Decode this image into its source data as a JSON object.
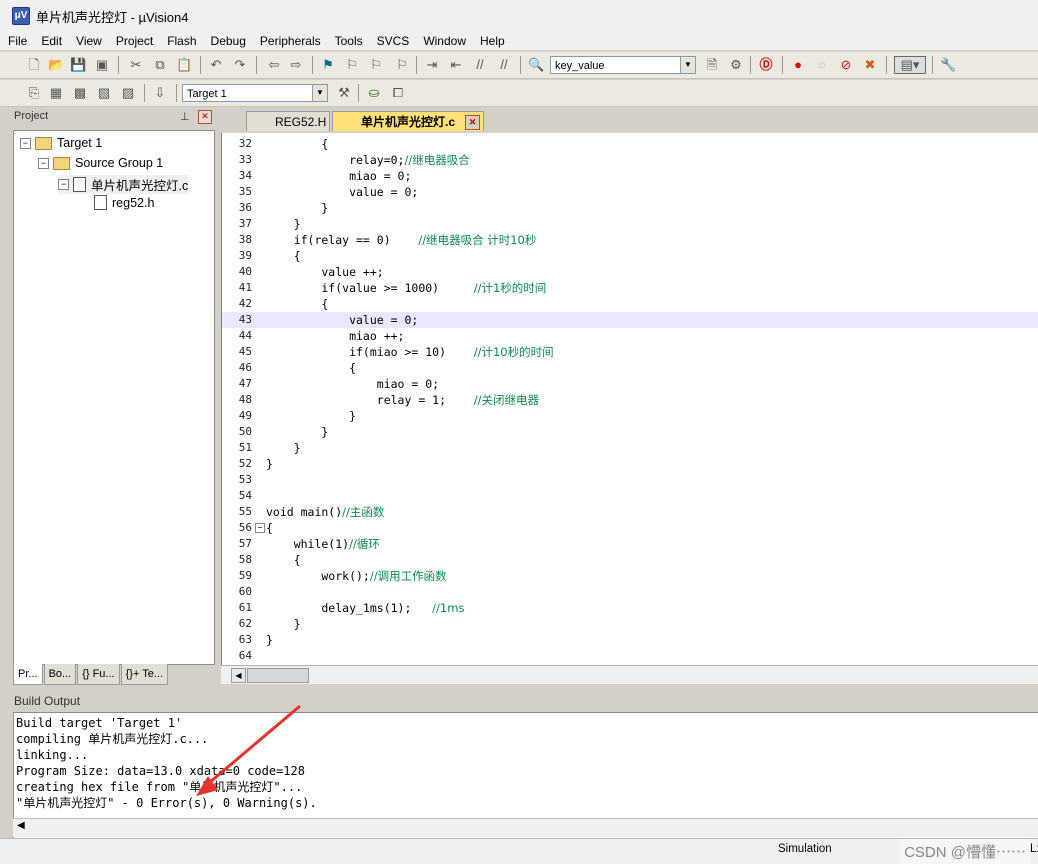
{
  "window": {
    "title": "单片机声光控灯  - µVision4",
    "app_icon": "uvision-icon"
  },
  "menu": [
    "File",
    "Edit",
    "View",
    "Project",
    "Flash",
    "Debug",
    "Peripherals",
    "Tools",
    "SVCS",
    "Window",
    "Help"
  ],
  "toolbar": {
    "find_combo_value": "key_value",
    "target_combo_value": "Target 1"
  },
  "project_panel": {
    "title": "Project",
    "tree": {
      "target": "Target 1",
      "group": "Source Group 1",
      "file1": "单片机声光控灯.c",
      "file2": "reg52.h"
    },
    "tabs": [
      "Pr...",
      "Bo...",
      "{} Fu...",
      "{}+ Te..."
    ]
  },
  "editor": {
    "tabs": [
      "REG52.H",
      "单片机声光控灯.c"
    ],
    "active_tab": 1,
    "current_line": 43,
    "lines": [
      {
        "n": "32",
        "t": "        {"
      },
      {
        "n": "33",
        "t": "            relay=0;",
        "c": "//继电器吸合"
      },
      {
        "n": "34",
        "t": "            miao = 0;"
      },
      {
        "n": "35",
        "t": "            value = 0;"
      },
      {
        "n": "36",
        "t": "        }"
      },
      {
        "n": "37",
        "t": "    }"
      },
      {
        "n": "38",
        "t": "    if(relay == 0)    ",
        "c": "//继电器吸合 计时10秒"
      },
      {
        "n": "39",
        "t": "    {"
      },
      {
        "n": "40",
        "t": "        value ++;"
      },
      {
        "n": "41",
        "t": "        if(value >= 1000)     ",
        "c": "//计1秒的时间"
      },
      {
        "n": "42",
        "t": "        {"
      },
      {
        "n": "43",
        "t": "            value = 0;"
      },
      {
        "n": "44",
        "t": "            miao ++;"
      },
      {
        "n": "45",
        "t": "            if(miao >= 10)    ",
        "c": "//计10秒的时间"
      },
      {
        "n": "46",
        "t": "            {"
      },
      {
        "n": "47",
        "t": "                miao = 0;"
      },
      {
        "n": "48",
        "t": "                relay = 1;    ",
        "c": "//关闭继电器"
      },
      {
        "n": "49",
        "t": "            }"
      },
      {
        "n": "50",
        "t": "        }"
      },
      {
        "n": "51",
        "t": "    }"
      },
      {
        "n": "52",
        "t": "}"
      },
      {
        "n": "53",
        "t": ""
      },
      {
        "n": "54",
        "t": ""
      },
      {
        "n": "55",
        "t": "void main()",
        "c": "//主函数"
      },
      {
        "n": "56",
        "t": "{"
      },
      {
        "n": "57",
        "t": "    while(1)",
        "c": "//循环"
      },
      {
        "n": "58",
        "t": "    {"
      },
      {
        "n": "59",
        "t": "        work();",
        "c": "//调用工作函数"
      },
      {
        "n": "60",
        "t": ""
      },
      {
        "n": "61",
        "t": "        delay_1ms(1);   ",
        "c": "//1ms"
      },
      {
        "n": "62",
        "t": "    }"
      },
      {
        "n": "63",
        "t": "}"
      },
      {
        "n": "64",
        "t": ""
      }
    ]
  },
  "build_output": {
    "title": "Build Output",
    "lines": [
      "Build target 'Target 1'",
      "compiling 单片机声光控灯.c...",
      "linking...",
      "Program Size: data=13.0 xdata=0 code=128",
      "creating hex file from \"单片机声光控灯\"...",
      "\"单片机声光控灯\" - 0 Error(s), 0 Warning(s)."
    ]
  },
  "status": {
    "mode": "Simulation",
    "right_cut": "L:",
    "watermark": "CSDN @懵懂⋯⋯"
  },
  "colors": {
    "active_tab": "#ffe17a",
    "comment": "#0a8a4a",
    "arrow": "#e8312a"
  }
}
